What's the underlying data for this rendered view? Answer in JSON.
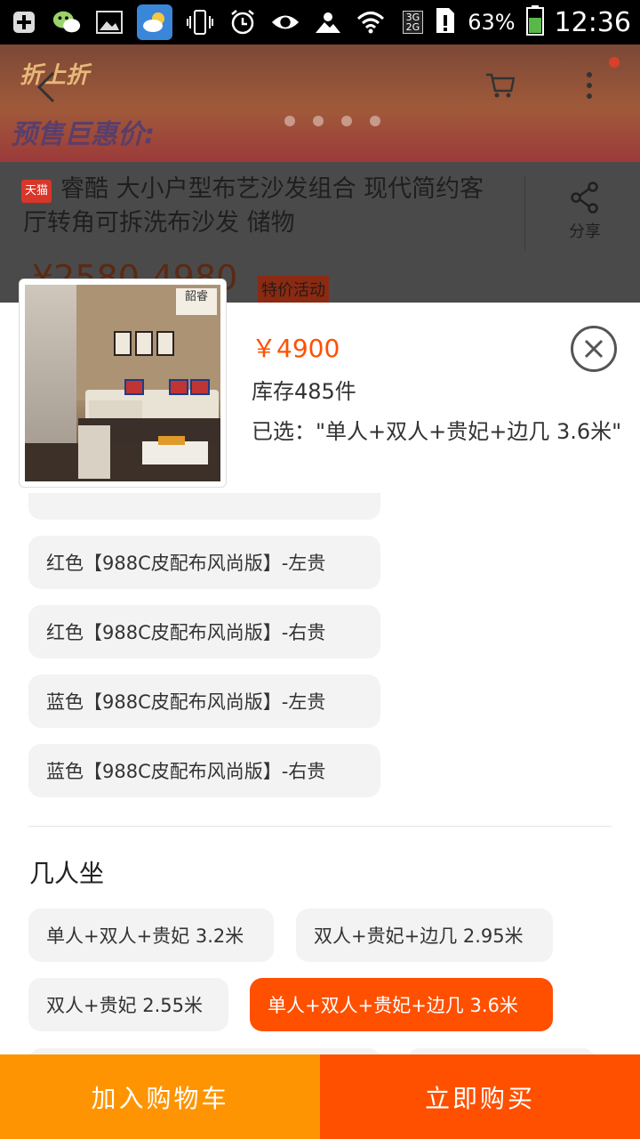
{
  "status_bar": {
    "battery": "63%",
    "time": "12:36",
    "network": "3G",
    "network2": "2G",
    "left_icons": [
      "notification-plus-icon",
      "wechat-icon",
      "gallery-icon",
      "weather-icon",
      "vibrate-icon",
      "alarm-icon",
      "eye-icon",
      "brightness-icon",
      "wifi-icon"
    ]
  },
  "background_page": {
    "banner_text1": "折上折",
    "banner_text2": "预售巨惠价:",
    "tmall_badge": "天猫",
    "title": "睿酷 大小户型布艺沙发组合 现代简约客厅转角可拆洗布沙发 储物",
    "share_label": "分享",
    "price_range": "¥2580-4980",
    "promo_tag": "特价活动"
  },
  "sheet": {
    "price": "￥4900",
    "stock": "库存485件",
    "selected": "已选：\"单人+双人+贵妃+边几 3.6米\"",
    "thumb_logo": "韶睿",
    "color_options": [
      "红色【988C皮配布风尚版】-左贵",
      "红色【988C皮配布风尚版】-右贵",
      "蓝色【988C皮配布风尚版】-左贵",
      "蓝色【988C皮配布风尚版】-右贵"
    ],
    "seat_section_title": "几人坐",
    "seat_options": [
      "单人+双人+贵妃 3.2米",
      "双人+贵妃+边几 2.95米",
      "双人+贵妃 2.55米",
      "单人+双人+贵妃+边几 3.6米"
    ],
    "active_seat_index": 3
  },
  "bottom_bar": {
    "add_to_cart": "加入购物车",
    "buy_now": "立即购买"
  },
  "colors": {
    "accent": "#ff5000",
    "cart_button": "#ff9402",
    "option_bg": "#f3f3f3"
  }
}
